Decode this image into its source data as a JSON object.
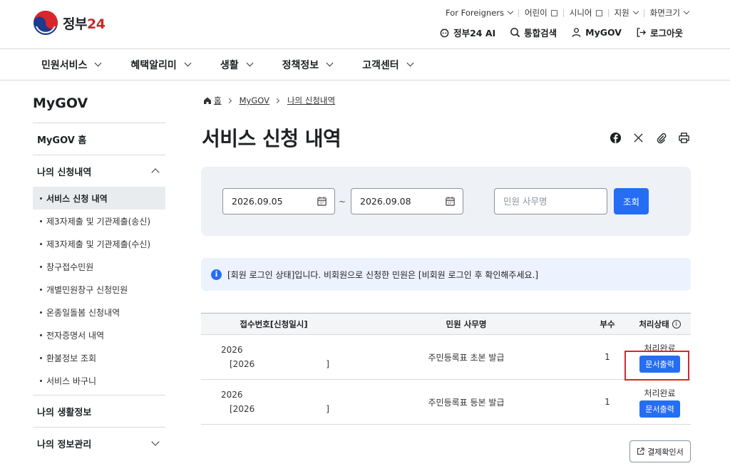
{
  "header": {
    "logo_text": "정부",
    "logo_num": "24",
    "util_top": [
      {
        "label": "For Foreigners",
        "icon": "chevron-down-icon"
      },
      {
        "label": "어린이",
        "icon": "external-link-icon"
      },
      {
        "label": "시니어",
        "icon": "external-link-icon"
      },
      {
        "label": "지원",
        "icon": "chevron-down-icon"
      },
      {
        "label": "화면크기",
        "icon": "chevron-down-icon"
      }
    ],
    "util_main": {
      "ai": "정부24 AI",
      "search": "통합검색",
      "mygov": "MyGOV",
      "logout": "로그아웃"
    }
  },
  "gnb": [
    "민원서비스",
    "혜택알리미",
    "생활",
    "정책정보",
    "고객센터"
  ],
  "sidebar": {
    "title": "MyGOV",
    "home": "MyGOV 홈",
    "section1": "나의 신청내역",
    "items": [
      "서비스 신청 내역",
      "제3자제출 및 기관제출(송신)",
      "제3자제출 및 기관제출(수신)",
      "창구접수민원",
      "개별민원창구 신청민원",
      "온종일돌봄 신청내역",
      "전자증명서 내역",
      "환불정보 조회",
      "서비스 바구니"
    ],
    "section2": "나의 생활정보",
    "section3": "나의 정보관리"
  },
  "breadcrumb": {
    "home": "홈",
    "mygov": "MyGOV",
    "current": "나의 신청내역"
  },
  "page_title": "서비스 신청 내역",
  "search": {
    "date_from": "2026.09.05",
    "tilde": "~",
    "date_to": "2026.09.08",
    "name_placeholder": "민원 사무명",
    "submit": "조회"
  },
  "notice": {
    "icon": "i",
    "text": "[회원 로그인 상태]입니다. 비회원으로 신청한 민원은 [비회원 로그인 후 확인해주세요.]"
  },
  "table": {
    "headers": {
      "receipt": "접수번호[신청일시]",
      "name": "민원 사무명",
      "copies": "부수",
      "status": "처리상태",
      "status_info": "i"
    },
    "rows": [
      {
        "receipt_line1": "2026",
        "receipt_line2_open": "[2026",
        "receipt_line2_close": "]",
        "name": "주민등록표 초본 발급",
        "copies": "1",
        "status": "처리완료",
        "action": "문서출력"
      },
      {
        "receipt_line1": "2026",
        "receipt_line2_open": "[2026",
        "receipt_line2_close": "]",
        "name": "주민등록표 등본 발급",
        "copies": "1",
        "status": "처리완료",
        "action": "문서출력"
      }
    ]
  },
  "payment_button": "결제확인서",
  "colors": {
    "primary": "#256ef4",
    "highlight": "#d9262b",
    "panel_bg": "#eef1f5",
    "notice_bg": "#ecf2fe"
  }
}
